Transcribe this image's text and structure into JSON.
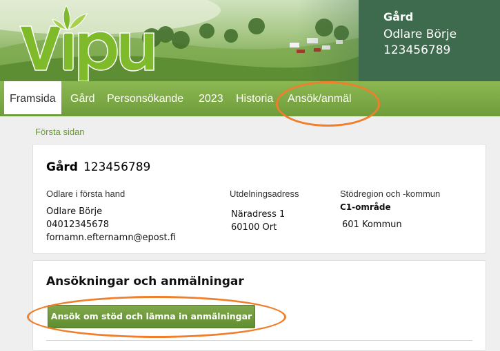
{
  "header": {
    "logo_text": "vipu",
    "farm_label": "Gård",
    "farmer_name": "Odlare Börje",
    "farm_id": "123456789"
  },
  "nav": {
    "items": [
      {
        "label": "Framsida",
        "active": true
      },
      {
        "label": "Gård",
        "active": false
      },
      {
        "label": "Personsökande",
        "active": false
      },
      {
        "label": "2023",
        "active": false
      },
      {
        "label": "Historia",
        "active": false
      },
      {
        "label": "Ansök/anmäl",
        "active": false
      }
    ]
  },
  "breadcrumb": "Första sidan",
  "farm_card": {
    "title_label": "Gård",
    "title_id": "123456789",
    "owner_label": "Odlare i första hand",
    "owner_name": "Odlare Börje",
    "owner_phone": "04012345678",
    "owner_email": "fornamn.efternamn@epost.fi",
    "address_label": "Utdelningsadress",
    "address_line1": "Näradress 1",
    "address_line2": "60100 Ort",
    "region_label": "Stödregion och -kommun",
    "region_value": "C1-område",
    "municipality": "601 Kommun"
  },
  "applications": {
    "title": "Ansökningar och anmälningar",
    "apply_button": "Ansök om stöd och lämna in anmälningar"
  },
  "colors": {
    "nav_green": "#7aa845",
    "header_dark_green": "#3e6b4d",
    "highlight_orange": "#f07e2a",
    "link_green": "#6a9a32"
  }
}
